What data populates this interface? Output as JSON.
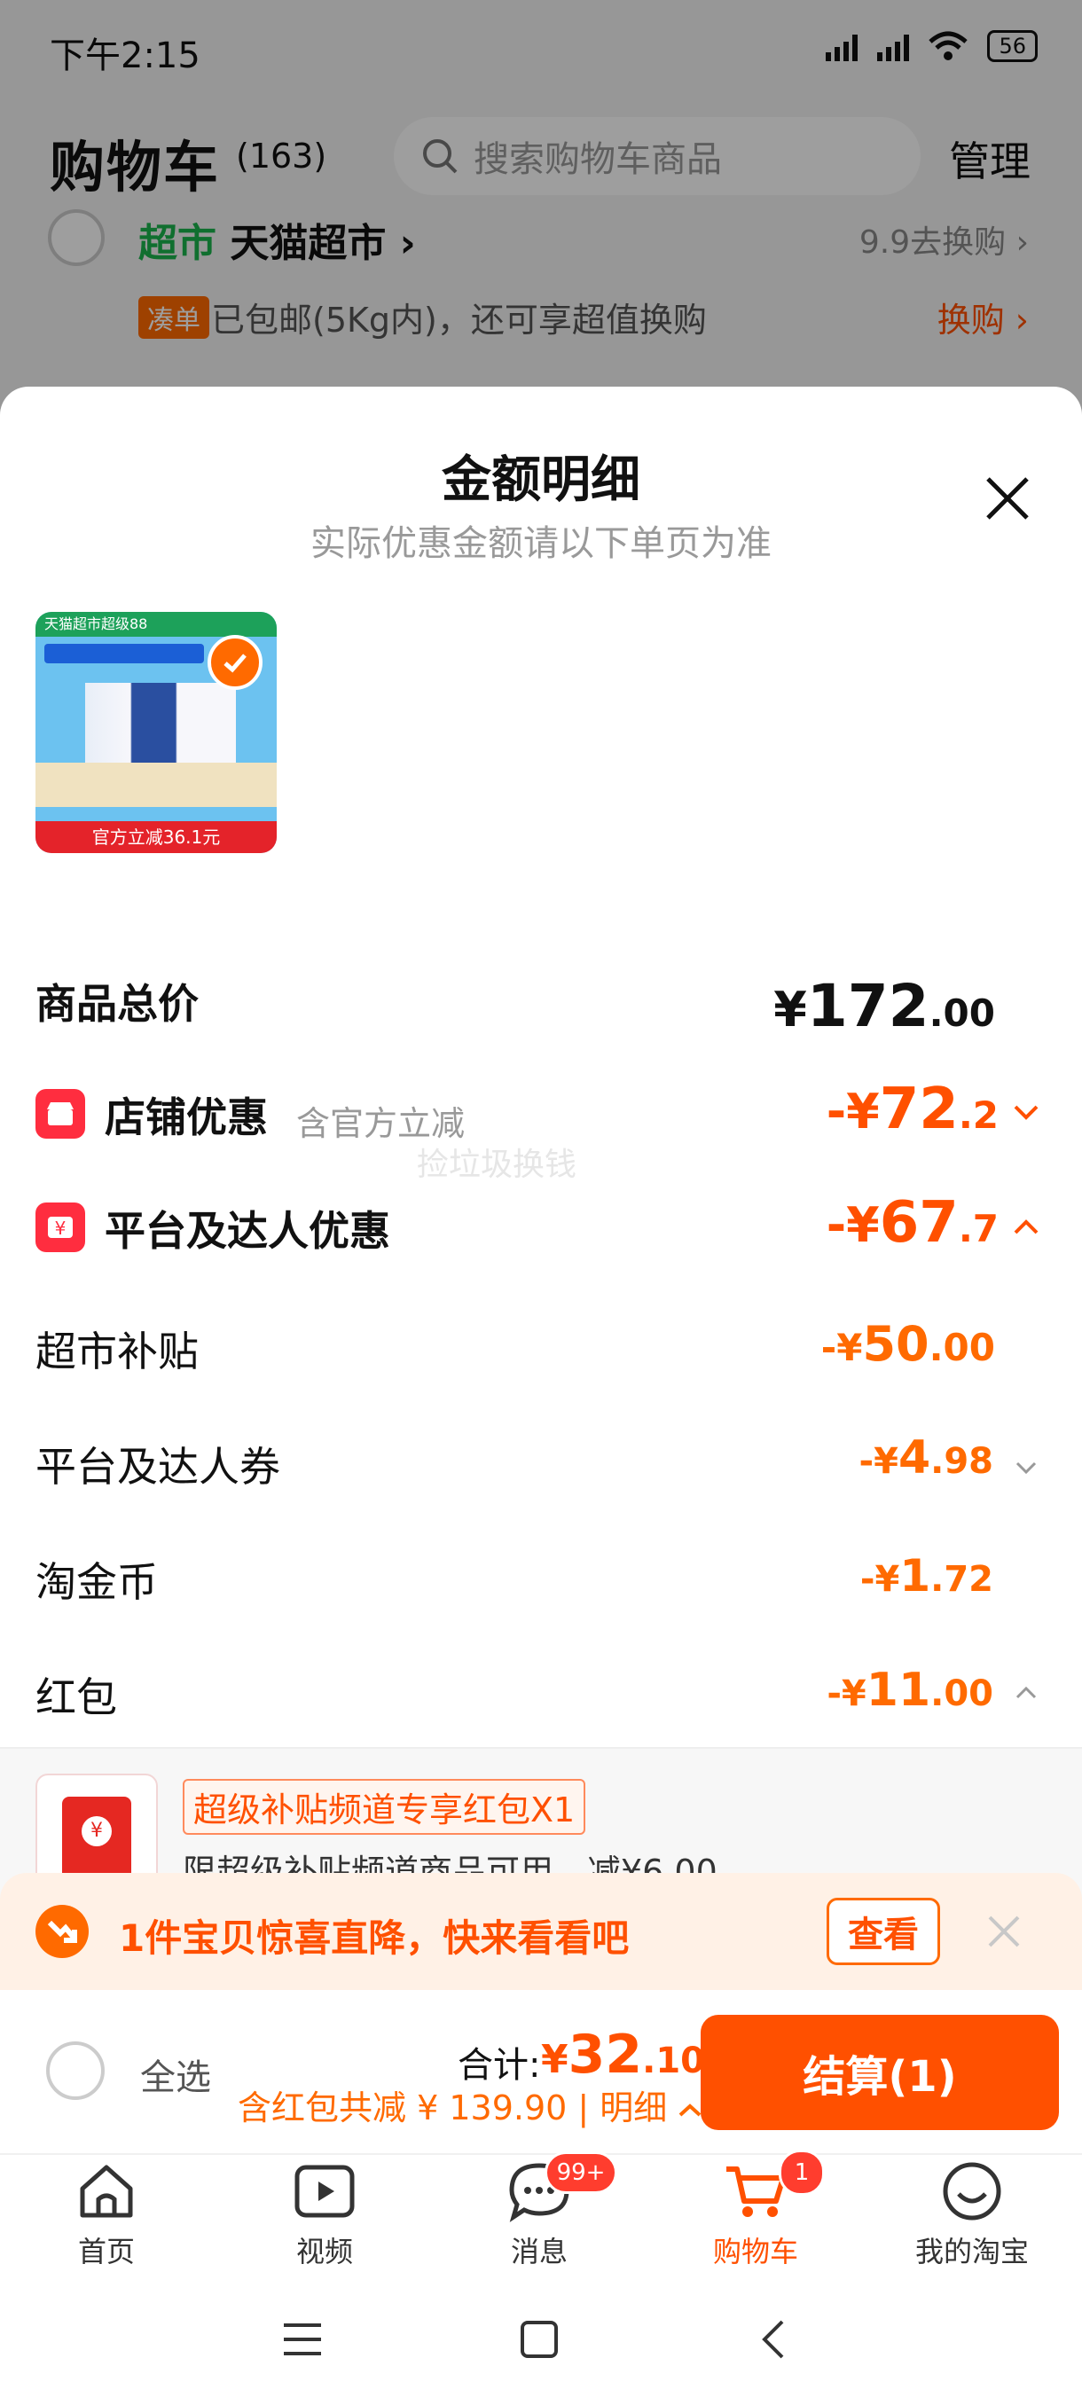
{
  "status_bar": {
    "time": "下午2:15",
    "battery": "56"
  },
  "cart_header": {
    "title": "购物车",
    "count": "(163)",
    "search_placeholder": "搜索购物车商品",
    "manage_label": "管理"
  },
  "shop": {
    "tag": "超市",
    "name": "天猫超市",
    "exchange": "9.9去换购",
    "promo_tag": "凑单",
    "promo_text": "已包邮(5Kg内)，还可享超值换购",
    "promo_link": "换购"
  },
  "sheet": {
    "title": "金额明细",
    "subtitle": "实际优惠金额请以下单页为准",
    "thumb_text": {
      "top": "天猫超市超级88",
      "bottom": "官方立减36.1元"
    },
    "watermark": "捡垃圾换钱",
    "rows": {
      "total": {
        "label": "商品总价",
        "yen": "¥",
        "main": "172",
        "dec": ".00"
      },
      "store_discount": {
        "label": "店铺优惠",
        "note": "含官方立减",
        "prefix": "-¥",
        "main": "72",
        "dec": ".2"
      },
      "platform_discount": {
        "label": "平台及达人优惠",
        "prefix": "-¥",
        "main": "67",
        "dec": ".7"
      },
      "supermarket_subsidy": {
        "label": "超市补贴",
        "prefix": "-¥",
        "main": "50",
        "dec": ".00"
      },
      "platform_coupon": {
        "label": "平台及达人券",
        "prefix": "-¥",
        "main": "4",
        "dec": ".98"
      },
      "taojinbi": {
        "label": "淘金币",
        "prefix": "-¥",
        "main": "1",
        "dec": ".72"
      },
      "red_packet": {
        "label": "红包",
        "prefix": "-¥",
        "main": "11",
        "dec": ".00"
      }
    },
    "red_packet_item": {
      "tag": "超级补贴频道专享红包X1",
      "desc": "限超级补贴频道商品可用，减¥6.00"
    }
  },
  "price_drop": {
    "text": "1件宝贝惊喜直降，快来看看吧",
    "button": "查看"
  },
  "checkout": {
    "select_all": "全选",
    "total_label": "合计:",
    "total_yen": "¥",
    "total_main": "32",
    "total_dec": ".10",
    "note": "含红包共减 ¥ 139.90 | 明细",
    "button": "结算(1)"
  },
  "tabs": [
    {
      "label": "首页"
    },
    {
      "label": "视频"
    },
    {
      "label": "消息",
      "badge": "99+"
    },
    {
      "label": "购物车",
      "badge": "1"
    },
    {
      "label": "我的淘宝"
    }
  ],
  "colors": {
    "accent": "#ff5000",
    "secondary_orange": "#ff6a00",
    "supermarket_green": "#1bb34c",
    "badge_red": "#ff2d3f"
  }
}
